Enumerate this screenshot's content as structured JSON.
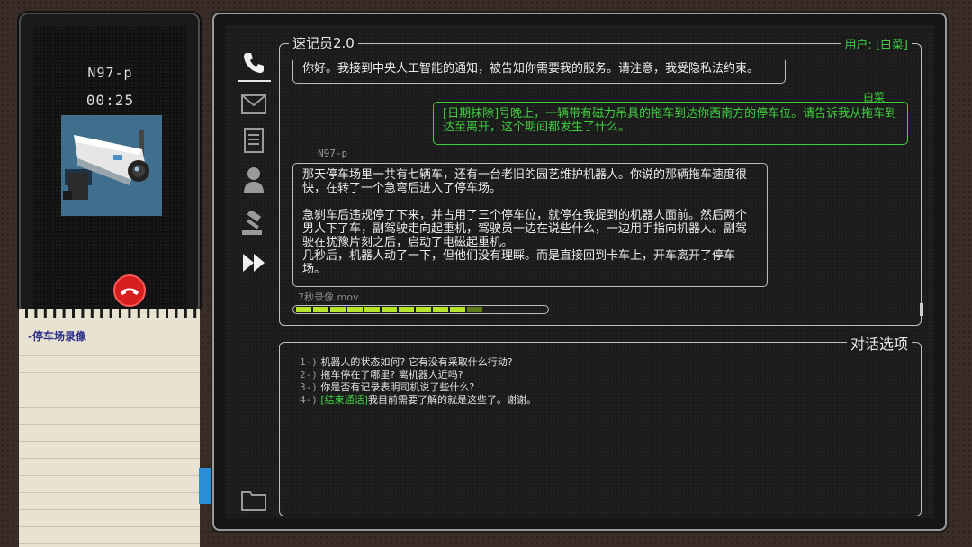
{
  "phone": {
    "caller_name": "N97-p",
    "call_timer": "00:25",
    "avatar": "security-camera",
    "hangup_icon": "phone-hangup-icon",
    "hangup_color": "#d71f1f"
  },
  "notepad": {
    "title": "-停车场录像"
  },
  "app": {
    "title": "速记员2.0",
    "user_label": "用户: [白菜]",
    "sidebar": [
      "phone-icon",
      "mail-icon",
      "document-icon",
      "person-icon",
      "gavel-icon",
      "fast-forward-icon",
      "folder-icon"
    ]
  },
  "transcript": {
    "msg0": "你好。我接到中央人工智能的通知，被告知你需要我的服务。请注意，我受隐私法约束。",
    "user_sender": "白菜",
    "user_msg_tag": "[日期抹除]",
    "user_msg": "号晚上，一辆带有磁力吊具的拖车到达你西南方的停车位。请告诉我从拖车到达至离开，这个期间都发生了什么。",
    "npc_sender": "N97-p",
    "npc_p1": "那天停车场里一共有七辆车，还有一台老旧的园艺维护机器人。你说的那辆拖车速度很快，在转了一个急弯后进入了停车场。",
    "npc_p2": "急刹车后违规停了下来，并占用了三个停车位，就停在我提到的机器人面前。然后两个男人下了车，副驾驶走向起重机，驾驶员一边在说些什么，一边用手指向机器人。副驾驶在犹豫片刻之后，启动了电磁起重机。",
    "npc_p3": "几秒后，机器人动了一下，但他们没有理睬。而是直接回到卡车上，开车离开了停车场。",
    "attachment": "7秒录像.mov",
    "progress": 0.8
  },
  "options": {
    "title": "对话选项",
    "items": [
      {
        "num": "1-)",
        "tag": "",
        "text": "机器人的状态如何? 它有没有采取什么行动?"
      },
      {
        "num": "2-)",
        "tag": "",
        "text": "拖车停在了哪里? 离机器人近吗?"
      },
      {
        "num": "3-)",
        "tag": "",
        "text": "你是否有记录表明司机说了些什么?"
      },
      {
        "num": "4-)",
        "tag": "[结束通话]",
        "text": "我目前需要了解的就是这些了。谢谢。"
      }
    ]
  },
  "colors": {
    "accent_green": "#3fcf3f",
    "progress_green": "#b6e62a",
    "notepad_title": "#2a2f8a"
  }
}
